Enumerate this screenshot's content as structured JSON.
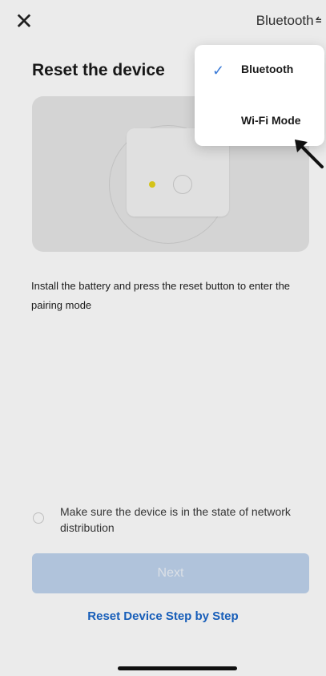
{
  "header": {
    "close_icon": "close-icon",
    "mode_label": "Bluetooth",
    "swap_icon": "swap-icon"
  },
  "page": {
    "title": "Reset the device",
    "instruction": "Install the battery and press the reset button to enter the pairing mode",
    "confirm_label": "Make sure the device is in the state of network distribution",
    "next_label": "Next",
    "help_link": "Reset Device Step by Step"
  },
  "dropdown": {
    "items": [
      {
        "label": "Bluetooth",
        "selected": true
      },
      {
        "label": "Wi-Fi Mode",
        "selected": false
      }
    ]
  },
  "colors": {
    "accent": "#3b7bd8",
    "link": "#1a66c9",
    "disabled_button": "#bfd4ee",
    "led": "#e7d41c"
  }
}
